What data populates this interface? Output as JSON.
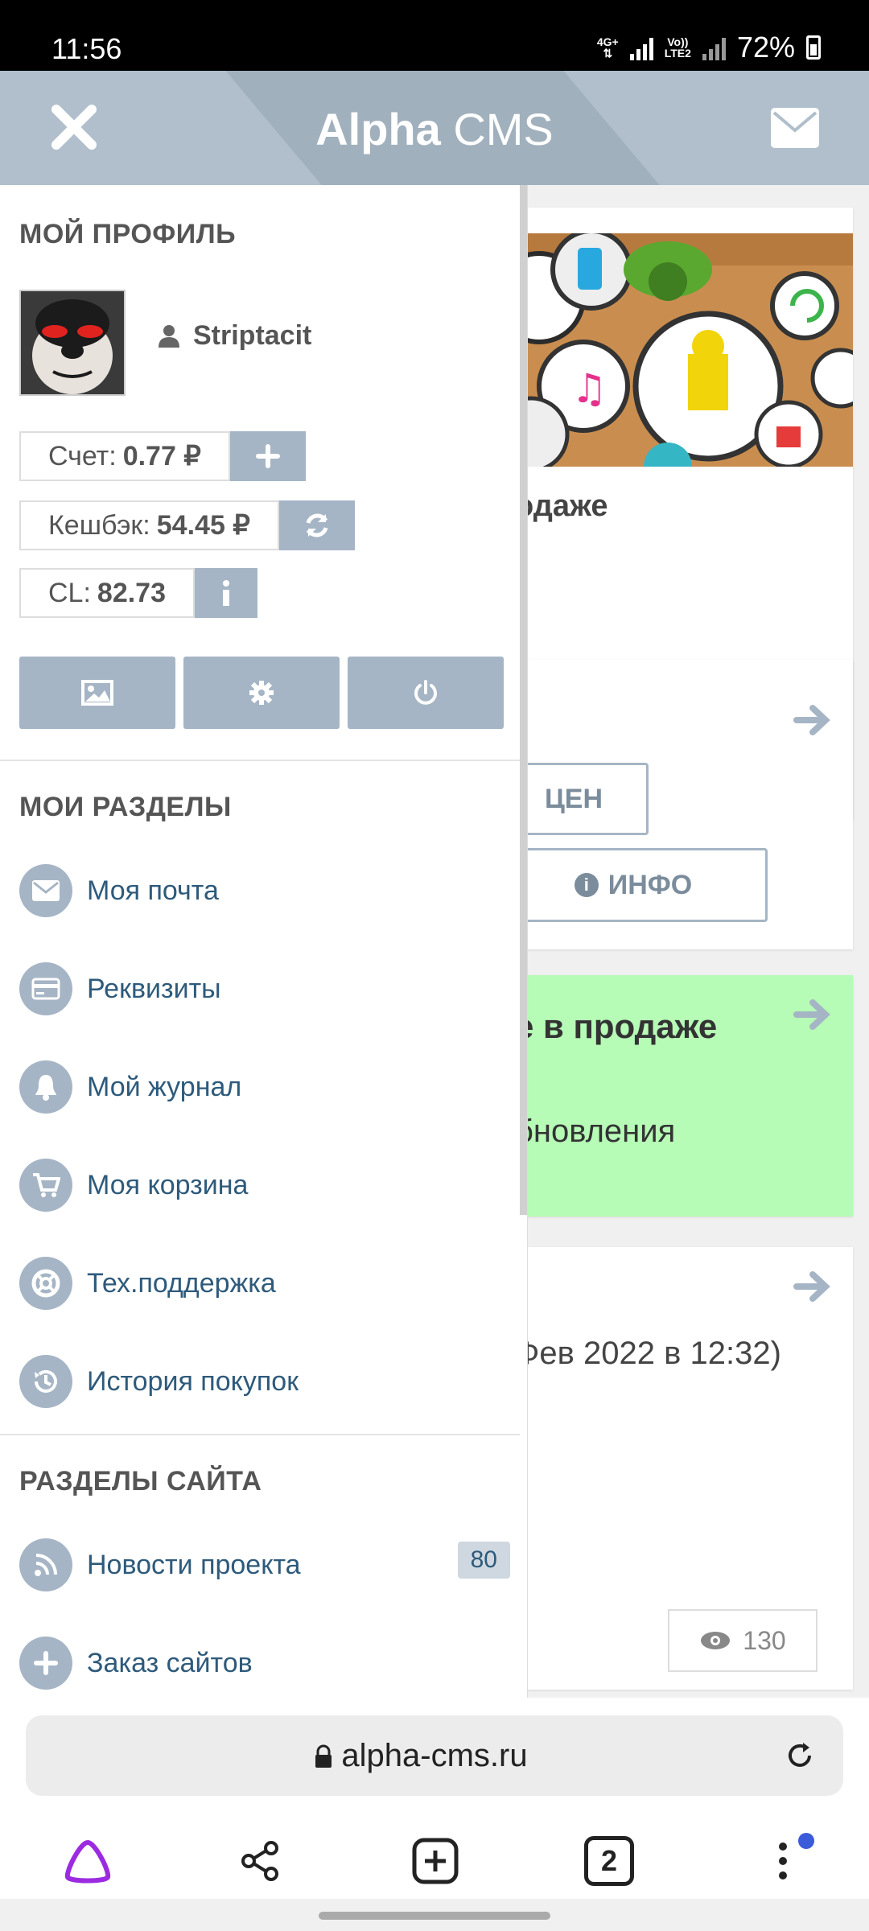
{
  "status_bar": {
    "time": "11:56",
    "net1": "4G+",
    "net2_top": "Vo))",
    "net2_bottom": "LTE2",
    "battery": "72%"
  },
  "header": {
    "title_bold": "Alpha",
    "title_rest": " CMS"
  },
  "background": {
    "card1_text": "одаже",
    "card2_btn1": "ЦЕН",
    "card2_btn2": "ИНФО",
    "card3_title": "е в продаже",
    "card3_sub": "бновления",
    "card4_date": "Фев 2022 в 12:32)",
    "card4_views": "130",
    "card3_bg": "#b6fbb6"
  },
  "drawer": {
    "profile_title": "МОЙ ПРОФИЛЬ",
    "username": "Striptacit",
    "account_label": "Счет:",
    "account_value": "0.77 ₽",
    "cashback_label": "Кешбэк:",
    "cashback_value": "54.45 ₽",
    "cl_label": "CL:",
    "cl_value": "82.73",
    "my_sections_title": "МОИ РАЗДЕЛЫ",
    "my_sections": [
      {
        "label": "Моя почта",
        "icon": "envelope-icon"
      },
      {
        "label": "Реквизиты",
        "icon": "credit-card-icon"
      },
      {
        "label": "Мой журнал",
        "icon": "bell-icon"
      },
      {
        "label": "Моя корзина",
        "icon": "cart-icon"
      },
      {
        "label": "Тех.поддержка",
        "icon": "lifebuoy-icon"
      },
      {
        "label": "История покупок",
        "icon": "history-icon"
      }
    ],
    "site_sections_title": "РАЗДЕЛЫ САЙТА",
    "site_sections": [
      {
        "label": "Новости проекта",
        "icon": "rss-icon",
        "badge": "80"
      },
      {
        "label": "Заказ сайтов",
        "icon": "plus-icon"
      }
    ]
  },
  "browser": {
    "url": "alpha-cms.ru",
    "tabs_count": "2"
  },
  "colors": {
    "header": "#b0bfcb",
    "accent": "#a5b5c5",
    "link": "#2e5a7b"
  }
}
